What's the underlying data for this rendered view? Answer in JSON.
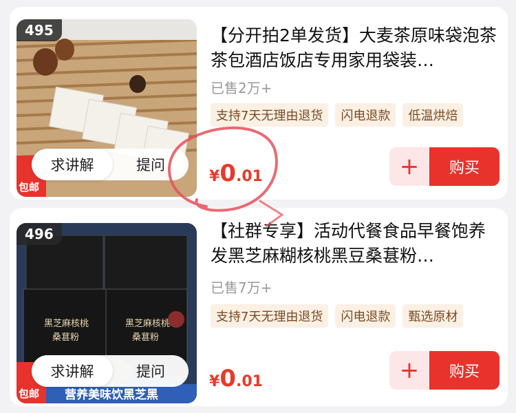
{
  "products": [
    {
      "rank": "495",
      "title": "【分开拍2单发货】大麦茶原味袋泡茶茶包酒店饭店专用家用袋装…",
      "sold": "已售2万+",
      "tags": [
        "支持7天无理由退货",
        "闪电退款",
        "低温烘焙"
      ],
      "price": {
        "currency": "¥",
        "int": "0",
        "dec": ".01"
      },
      "ask_label": "求讲解",
      "question_label": "提问",
      "buy_label": "购买",
      "plus_label": "+",
      "badge": "包邮"
    },
    {
      "rank": "496",
      "title": "【社群专享】活动代餐食品早餐饱养发黑芝麻糊核桃黑豆桑葚粉…",
      "sold": "已售7万+",
      "tags": [
        "支持7天无理由退货",
        "闪电退款",
        "甄选原材"
      ],
      "price": {
        "currency": "¥",
        "int": "0",
        "dec": ".01"
      },
      "ask_label": "求讲解",
      "question_label": "提问",
      "buy_label": "购买",
      "plus_label": "+",
      "badge": "包邮",
      "thumb_caption": "营养美味饮黑芝黑"
    }
  ],
  "colors": {
    "accent": "#e8332c",
    "price": "#e83a2c",
    "tag_bg": "#fbf0e4"
  }
}
